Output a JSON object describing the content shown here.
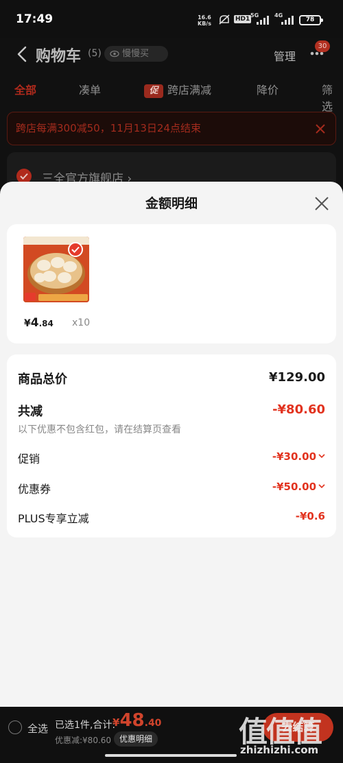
{
  "status_bar": {
    "time": "17:49",
    "net_speed_value": "16.6",
    "net_speed_unit": "KB/s",
    "hd_label": "HD1",
    "net_5g": "5G",
    "net_4g": "4G",
    "battery": "78"
  },
  "header": {
    "title": "购物车",
    "count": "(5)",
    "slow_buy_label": "慢慢买",
    "manage_label": "管理",
    "more_badge": "30"
  },
  "tabs": [
    {
      "label": "全部",
      "active": true
    },
    {
      "label": "凑单"
    },
    {
      "label": "跨店满减",
      "badge": "促"
    },
    {
      "label": "降价"
    },
    {
      "label": "筛选"
    }
  ],
  "promo_banner": {
    "text": "跨店每满300减50，11月13日24点结束"
  },
  "store": {
    "name": "三全官方旗舰店 ›"
  },
  "sheet": {
    "title": "金额明细",
    "product": {
      "price_symbol": "¥",
      "price_int": "4",
      "price_dec": ".84",
      "quantity": "x10"
    },
    "summary": {
      "subtotal_label": "商品总价",
      "subtotal_value": "¥129.00",
      "reduction_label": "共减",
      "reduction_value": "-¥80.60",
      "note": "以下优惠不包含红包，请在结算页查看",
      "rows": [
        {
          "label": "促销",
          "value": "-¥30.00"
        },
        {
          "label": "优惠券",
          "value": "-¥50.00"
        },
        {
          "label": "PLUS专享立减",
          "value": "-¥0.6"
        }
      ]
    }
  },
  "bottom_bar": {
    "select_all_label": "全选",
    "selected_label": "已选1件,合计:",
    "total_symbol": "¥",
    "total_int": "48",
    "total_dec": ".40",
    "discount_label": "优惠减:¥80.60",
    "detail_button": "优惠明细",
    "checkout_button": "去结算"
  },
  "watermark": {
    "logo": "值值值",
    "url": "zhizhizhi.com"
  },
  "colors": {
    "accent_red": "#e2331f",
    "sheet_bg": "#f4f4f4",
    "overlay_bg": "#0a0a0a"
  }
}
